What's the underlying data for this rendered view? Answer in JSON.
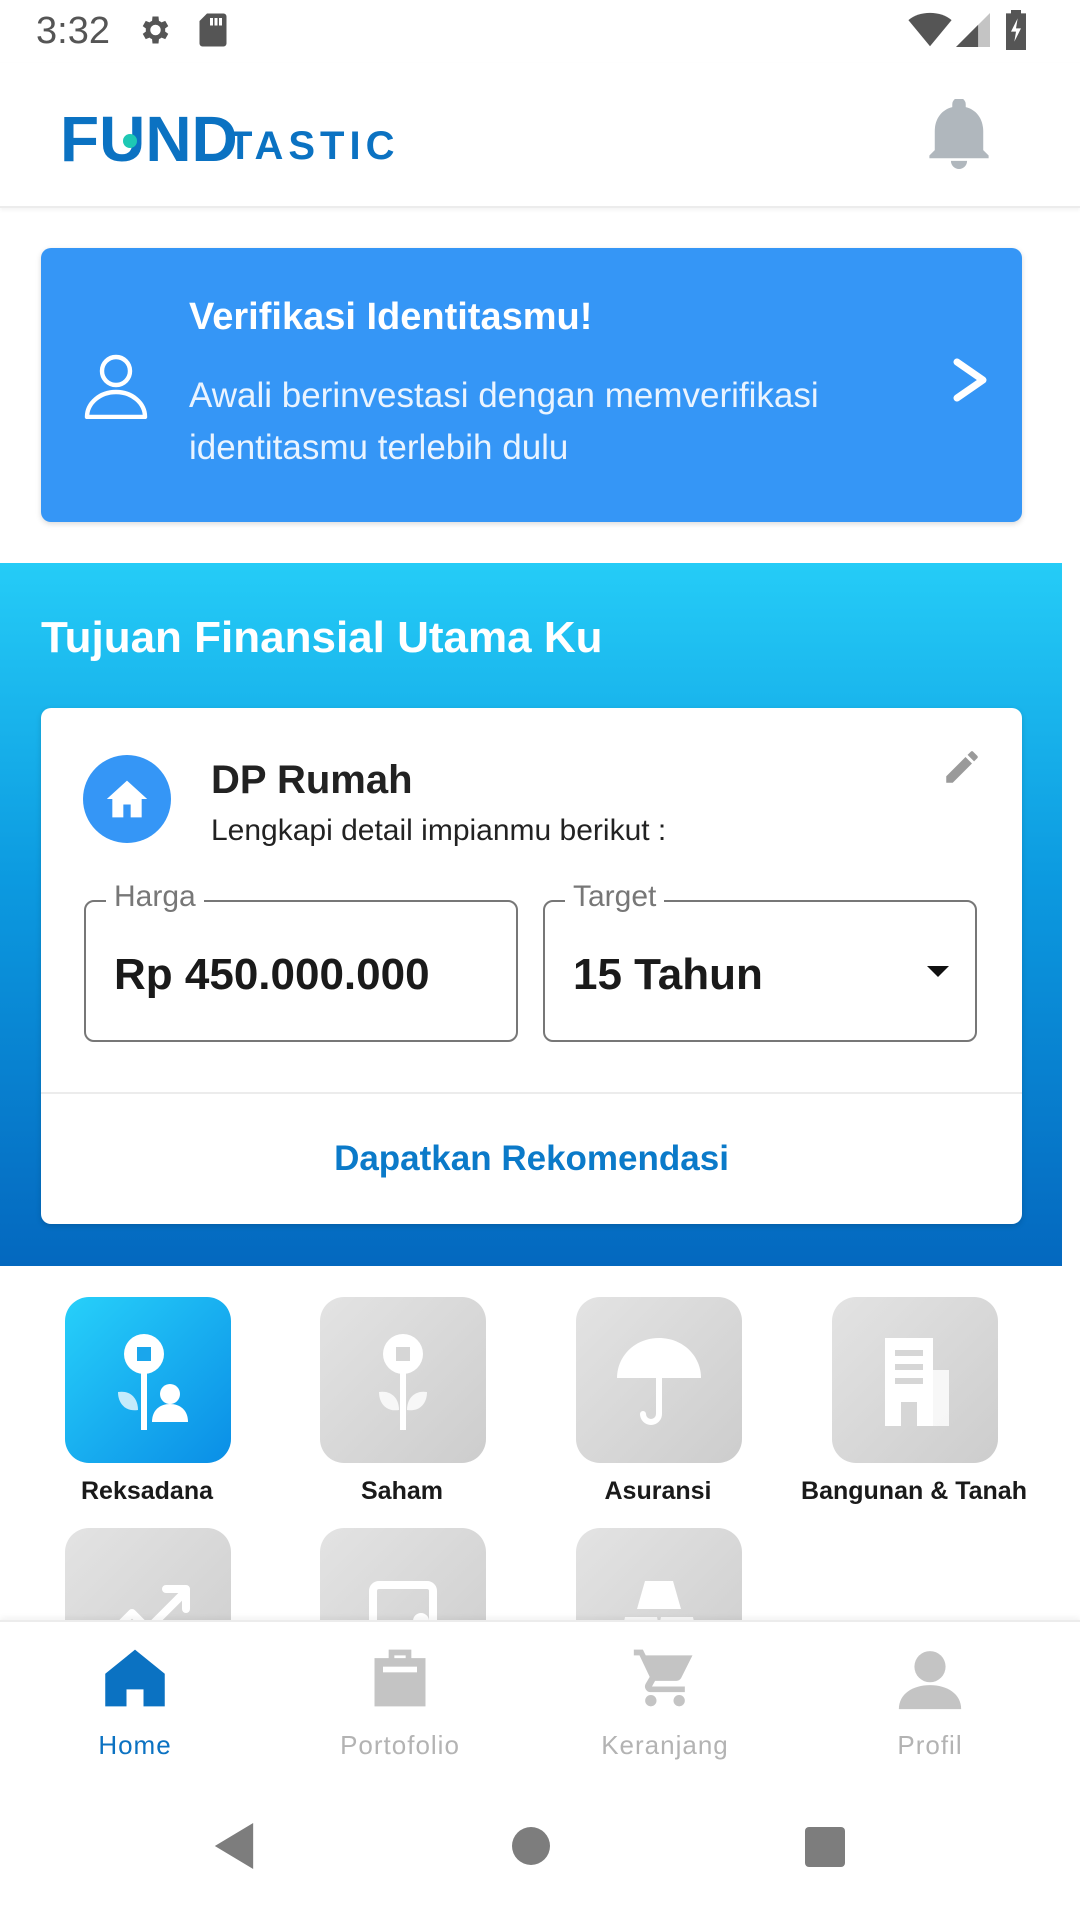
{
  "status_bar": {
    "time": "3:32"
  },
  "app": {
    "logo_text": "FUNDTASTIC",
    "logo_part1": "FUND",
    "logo_part2": "TASTIC",
    "colors": {
      "brand_blue": "#0b72c2",
      "brand_teal": "#1ec8b4",
      "banner_blue": "#3596f6"
    }
  },
  "verify_banner": {
    "title": "Verifikasi Identitasmu!",
    "description": "Awali berinvestasi dengan memverifikasi identitasmu terlebih dulu",
    "icon": "user-outline-icon",
    "arrow_icon": "chevron-right-icon"
  },
  "goal_section": {
    "heading": "Tujuan Finansial Utama Ku",
    "card": {
      "title": "DP Rumah",
      "subtitle": "Lengkapi detail impianmu berikut :",
      "icon": "house-icon",
      "price_label": "Harga",
      "price_value": "Rp 450.000.000",
      "target_label": "Target",
      "target_value": "15 Tahun",
      "action_label": "Dapatkan Rekomendasi"
    }
  },
  "products": [
    {
      "label": "Reksadana",
      "icon": "mutual-fund-icon",
      "active": true
    },
    {
      "label": "Saham",
      "icon": "stock-plant-icon",
      "active": false
    },
    {
      "label": "Asuransi",
      "icon": "umbrella-icon",
      "active": false
    },
    {
      "label": "Bangunan & Tanah",
      "icon": "building-icon",
      "active": false
    }
  ],
  "products_row2": [
    {
      "icon": "trend-up-icon"
    },
    {
      "icon": "wallet-icon"
    },
    {
      "icon": "gold-icon"
    }
  ],
  "bottom_nav": [
    {
      "label": "Home",
      "icon": "home-icon",
      "active": true
    },
    {
      "label": "Portofolio",
      "icon": "briefcase-icon",
      "active": false
    },
    {
      "label": "Keranjang",
      "icon": "cart-icon",
      "active": false
    },
    {
      "label": "Profil",
      "icon": "person-icon",
      "active": false
    }
  ]
}
